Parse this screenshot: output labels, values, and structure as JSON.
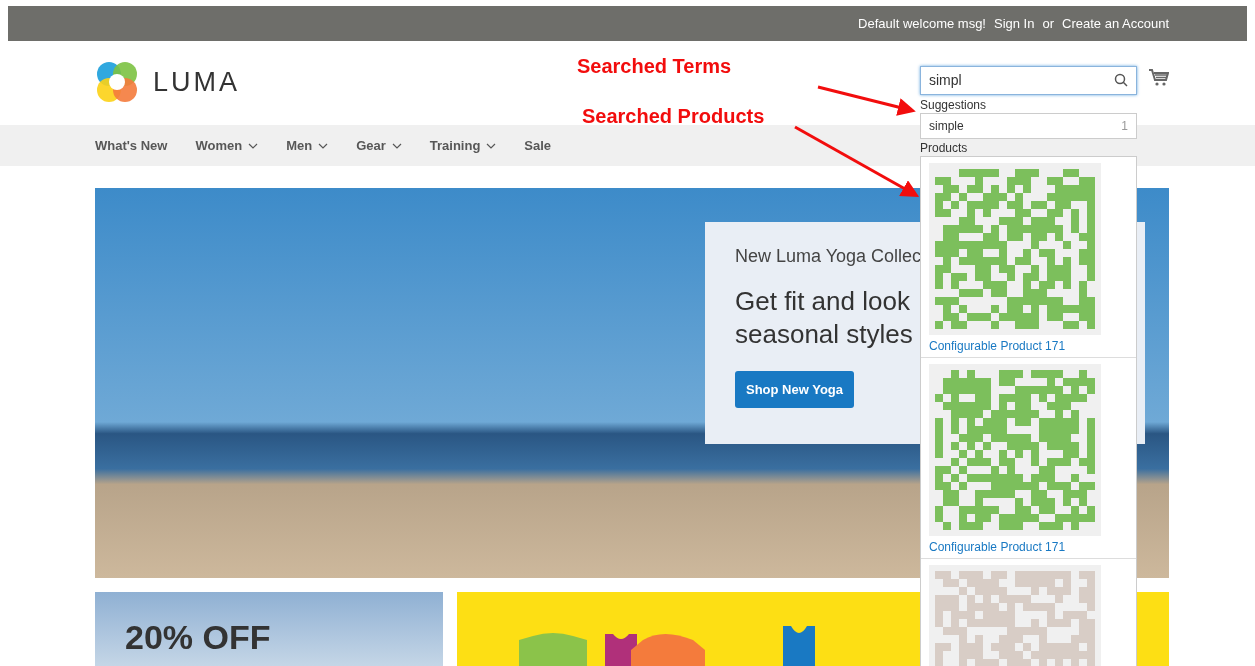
{
  "top_bar": {
    "welcome": "Default welcome msg!",
    "sign_in": "Sign In",
    "or": "or",
    "create_account": "Create an Account"
  },
  "header": {
    "logo_text": "LUMA",
    "search": {
      "value": "simpl"
    }
  },
  "search_dropdown": {
    "suggestions_label": "Suggestions",
    "suggestions": [
      {
        "term": "simple",
        "count": "1"
      }
    ],
    "products_label": "Products",
    "products": [
      {
        "name": "Configurable Product 171",
        "color": "#7cbf5c"
      },
      {
        "name": "Configurable Product 171",
        "color": "#7cbf5c"
      },
      {
        "color": "#d8cdc6"
      }
    ]
  },
  "annotations": [
    {
      "text": "Searched Terms"
    },
    {
      "text": "Searched Products"
    }
  ],
  "nav": [
    {
      "label": "What's New",
      "has_menu": false
    },
    {
      "label": "Women",
      "has_menu": true
    },
    {
      "label": "Men",
      "has_menu": true
    },
    {
      "label": "Gear",
      "has_menu": true
    },
    {
      "label": "Training",
      "has_menu": true
    },
    {
      "label": "Sale",
      "has_menu": false
    }
  ],
  "hero": {
    "kicker": "New Luma Yoga Collec",
    "headline": [
      "Get fit and look",
      "seasonal styles"
    ],
    "button": "Shop New Yoga"
  },
  "promos": [
    {
      "kind": "photo",
      "title": "20% OFF"
    },
    {
      "kind": "shirts"
    }
  ]
}
